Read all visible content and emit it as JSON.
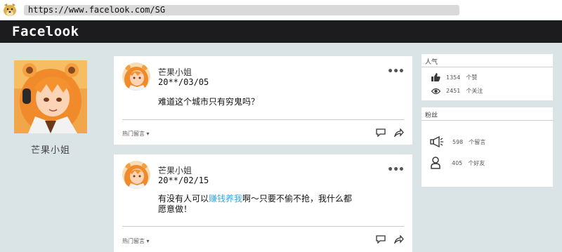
{
  "browser": {
    "url": "https://www.facelook.com/SG"
  },
  "header": {
    "logo": "Facelook"
  },
  "profile": {
    "name": "芒果小姐"
  },
  "posts": [
    {
      "author": "芒果小姐",
      "date": "20**/03/05",
      "text_parts": [
        "难道这个城市只有穷鬼吗？"
      ],
      "hot_comments_label": "热门留言 ▾"
    },
    {
      "author": "芒果小姐",
      "date": "20**/02/15",
      "text_before": "有没有人可以",
      "text_highlight": "赚钱养我",
      "text_after": "啊～只要不偷不抢，我什么都",
      "text_line2": "愿意做！",
      "hot_comments_label": "热门留言 ▾"
    }
  ],
  "sidebar": {
    "popularity": {
      "title": "人气",
      "likes_count": "1354",
      "likes_unit": "个赞",
      "follows_count": "2451",
      "follows_unit": "个关注"
    },
    "fans": {
      "title": "粉丝",
      "comments_count": "598",
      "comments_unit": "个留言",
      "friends_count": "405",
      "friends_unit": "个好友"
    }
  },
  "colors": {
    "header_bg": "#1c1c1e",
    "page_bg": "#dae3e6",
    "highlight": "#3aa6d8"
  }
}
